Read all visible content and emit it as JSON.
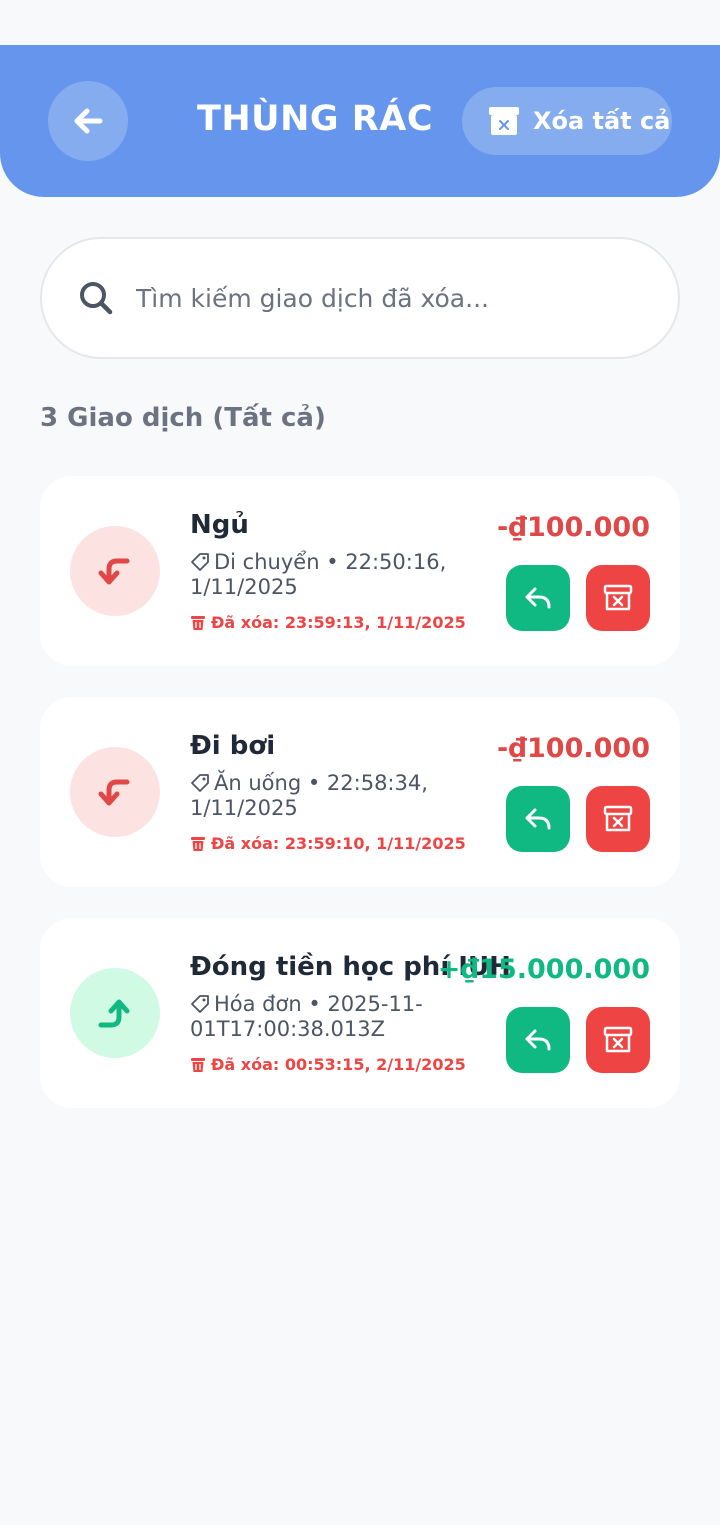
{
  "header": {
    "title": "THÙNG RÁC",
    "clear_all_label": "Xóa tất cả",
    "back_icon": "arrow-left-icon",
    "clear_icon": "trash-box-icon"
  },
  "search": {
    "placeholder": "Tìm kiếm giao dịch đã xóa...",
    "value": ""
  },
  "summary": {
    "count_label": "3 Giao dịch (Tất cả)"
  },
  "colors": {
    "header": "#6595ec",
    "expense": "#e04848",
    "income": "#10b981",
    "restore_button": "#10b981",
    "delete_button": "#ef4444"
  },
  "transactions": [
    {
      "title": "Ngủ",
      "category": "Di chuyển",
      "datetime": "• 22:50:16, 1/11/2025",
      "deleted_at": "Đã xóa: 23:59:13, 1/11/2025",
      "amount": "-₫100.000",
      "type": "expense"
    },
    {
      "title": "Đi bơi",
      "category": "Ăn uống",
      "datetime": "• 22:58:34, 1/11/2025",
      "deleted_at": "Đã xóa: 23:59:10, 1/11/2025",
      "amount": "-₫100.000",
      "type": "expense"
    },
    {
      "title": "Đóng tiền học phí IUH",
      "category": "Hóa đơn",
      "datetime": "• 2025-11-01T17:00:38.013Z",
      "deleted_at": "Đã xóa: 00:53:15, 2/11/2025",
      "amount": "+₫15.000.000",
      "type": "income"
    }
  ]
}
